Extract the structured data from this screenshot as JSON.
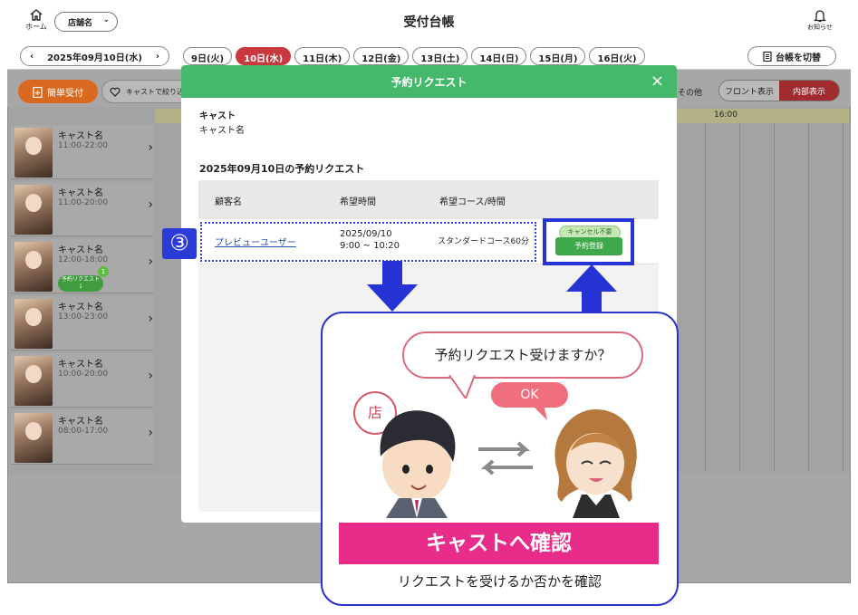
{
  "header": {
    "home_label": "ホーム",
    "store_select": "店舗名",
    "title": "受付台帳",
    "notify_label": "お知らせ"
  },
  "datebar": {
    "current_date": "2025年09月10日(水)",
    "day_tabs": [
      "9日(火)",
      "10日(水)",
      "11日(木)",
      "12日(金)",
      "13日(土)",
      "14日(日)",
      "15日(月)",
      "16日(火)"
    ],
    "ledger_switch": "台帳を切替"
  },
  "actions": {
    "quick_reception": "簡単受付",
    "cast_filter": "キャストで絞り込み",
    "other": "その他",
    "front_view": "フロント表示",
    "internal_view": "内部表示"
  },
  "timeline": {
    "time_label": "16:00"
  },
  "casts": [
    {
      "name": "キャスト名",
      "hours": "11:00-22:00"
    },
    {
      "name": "キャスト名",
      "hours": "11:00-20:00"
    },
    {
      "name": "キャスト名",
      "hours": "12:00-18:00",
      "badge": "予約リクエスト",
      "badge_count": "1",
      "badge_sub": "1"
    },
    {
      "name": "キャスト名",
      "hours": "13:00-23:00"
    },
    {
      "name": "キャスト名",
      "hours": "10:00-20:00"
    },
    {
      "name": "キャスト名",
      "hours": "08:00-17:00"
    }
  ],
  "modal": {
    "title": "予約リクエスト",
    "close": "×",
    "cast_label": "キャスト",
    "cast_value": "キャスト名",
    "section_title": "2025年09月10日の予約リクエスト",
    "columns": [
      "顧客名",
      "希望時間",
      "希望コース/時間"
    ],
    "rows": [
      {
        "customer": "プレビューユーザー",
        "time_date": "2025/09/10",
        "time_range": "9:00 ~ 10:20",
        "course": "スタンダードコース60分",
        "cancel_tag": "キャンセル不要",
        "register_button": "予約登録"
      }
    ]
  },
  "annotation": {
    "step_number": "③",
    "question": "予約リクエスト受けますか？",
    "ok": "OK",
    "store_tag": "店",
    "banner": "キャストへ確認",
    "caption": "リクエストを受けるか否かを確認"
  },
  "colors": {
    "accent_green": "#45b86b",
    "accent_red": "#c9383e",
    "highlight_blue": "#2633d4",
    "banner_pink": "#e82c8a"
  }
}
